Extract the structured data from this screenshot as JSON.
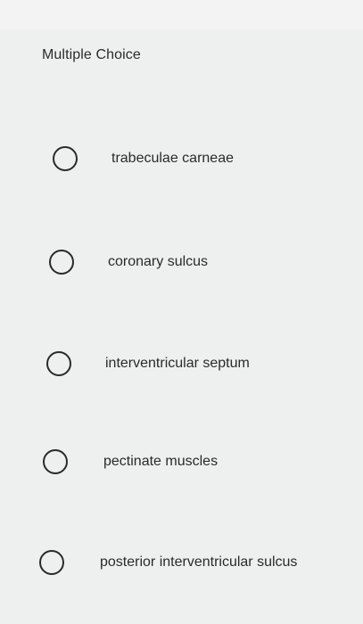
{
  "question": {
    "type_label": "Multiple Choice"
  },
  "options": [
    {
      "label": "trabeculae carneae"
    },
    {
      "label": "coronary sulcus"
    },
    {
      "label": "interventricular septum"
    },
    {
      "label": "pectinate muscles"
    },
    {
      "label": "posterior interventricular sulcus"
    }
  ]
}
